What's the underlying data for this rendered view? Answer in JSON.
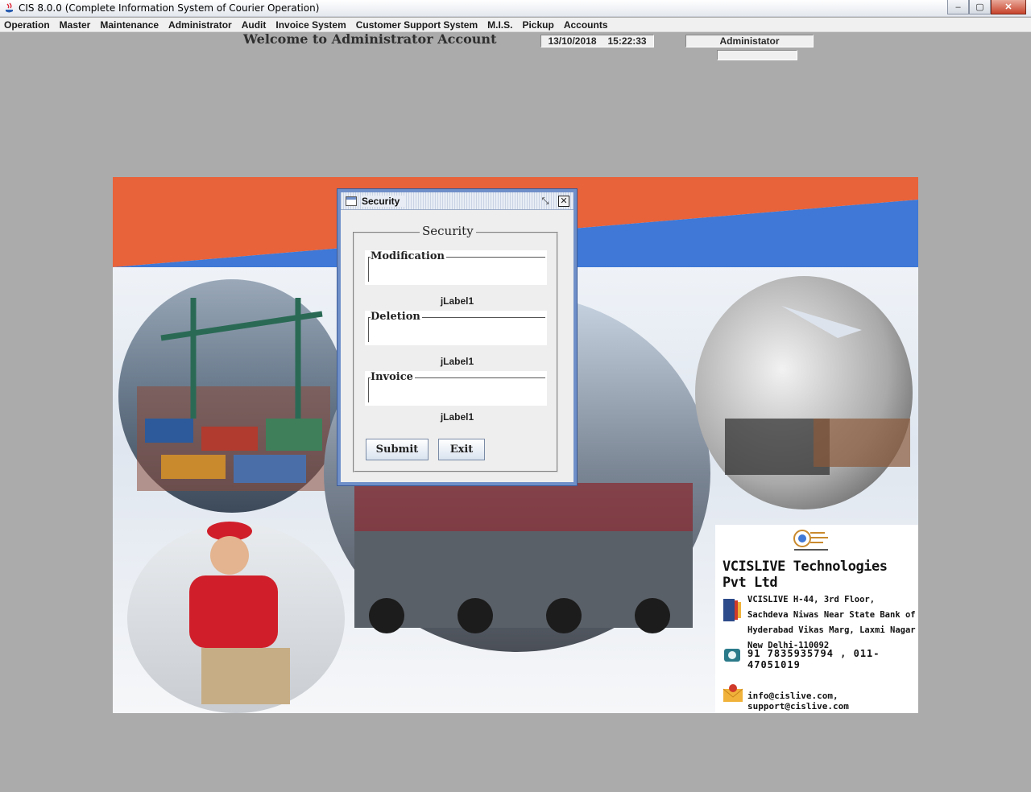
{
  "window": {
    "title": "CIS 8.0.0 (Complete Information System of Courier Operation)",
    "controls": {
      "minimize": "‒",
      "maximize": "▢",
      "close": "✕"
    }
  },
  "menu": [
    "Operation",
    "Master",
    "Maintenance",
    "Administrator",
    "Audit",
    "Invoice System",
    "Customer Support System",
    "M.I.S.",
    "Pickup",
    "Accounts"
  ],
  "header": {
    "welcome": "Welcome to Administrator Account",
    "date": "13/10/2018",
    "time": "15:22:33",
    "user": "Administator"
  },
  "company": {
    "name": "VCISLIVE Technologies Pvt Ltd",
    "address": "VCISLIVE H-44, 3rd Floor, Sachdeva Niwas Near State Bank of Hyderabad Vikas Marg, Laxmi Nagar New Delhi-110092",
    "phone": "91 7835935794 , 011-47051019",
    "email": "info@cislive.com, support@cislive.com"
  },
  "dialog": {
    "title": "Security",
    "group_title": "Security",
    "fields": [
      {
        "label": "Modification",
        "status": "jLabel1"
      },
      {
        "label": "Deletion",
        "status": "jLabel1"
      },
      {
        "label": "Invoice",
        "status": "jLabel1"
      }
    ],
    "submit_label": "Submit",
    "exit_label": "Exit",
    "restore_glyph": "⤡",
    "close_glyph": "✕"
  },
  "colors": {
    "desktop": "#ababab",
    "banner_orange": "#e8623a",
    "banner_blue": "#3f78d6",
    "dialog_border": "#6f8fc9"
  }
}
